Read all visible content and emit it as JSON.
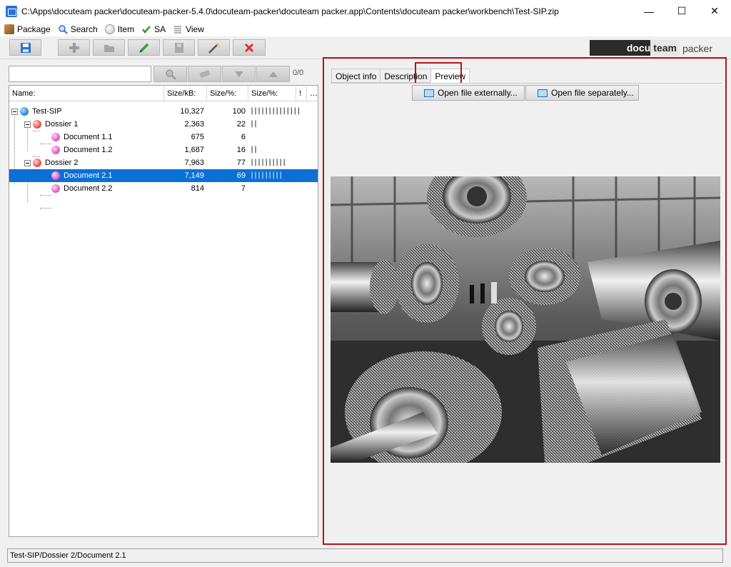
{
  "window": {
    "title": "C:\\Apps\\docuteam packer\\docuteam-packer-5.4.0\\docuteam-packer\\docuteam packer.app\\Contents\\docuteam packer\\workbench\\Test-SIP.zip",
    "minimize": "—",
    "maximize": "☐",
    "close": "✕"
  },
  "menu": {
    "items": [
      {
        "label": "Package",
        "icon": "package-icon"
      },
      {
        "label": "Search",
        "icon": "search-icon"
      },
      {
        "label": "Item",
        "icon": "item-icon"
      },
      {
        "label": "SA",
        "icon": "checkmark-icon"
      },
      {
        "label": "View",
        "icon": "list-icon"
      }
    ]
  },
  "toolbar": {
    "buttons": [
      "save-icon",
      "add-icon",
      "folder-icon",
      "edit-icon",
      "save-disabled-icon",
      "magic-wand-icon",
      "delete-icon"
    ],
    "delete_color": "#e03030",
    "edit_color": "#3aa03a"
  },
  "logo": {
    "part1": "docu",
    "part2": "team",
    "part3": "packer"
  },
  "search": {
    "value": "",
    "placeholder": "",
    "counter": "0/0"
  },
  "tree": {
    "columns": [
      "Name:",
      "Size/kB:",
      "Size/%:",
      "Size/%:",
      "!",
      "…"
    ],
    "rows": [
      {
        "name": "Test-SIP",
        "size_kb": "10,327",
        "size_pct": "100",
        "bars": "||||||||||||||",
        "level": 0,
        "type": "root",
        "expanded": true,
        "selected": false
      },
      {
        "name": "Dossier 1",
        "size_kb": "2,363",
        "size_pct": "22",
        "bars": "||",
        "level": 1,
        "type": "dossier",
        "expanded": true,
        "selected": false
      },
      {
        "name": "Document 1.1",
        "size_kb": "675",
        "size_pct": "6",
        "bars": "",
        "level": 2,
        "type": "doc",
        "selected": false
      },
      {
        "name": "Document 1.2",
        "size_kb": "1,687",
        "size_pct": "16",
        "bars": "||",
        "level": 2,
        "type": "doc",
        "selected": false
      },
      {
        "name": "Dossier 2",
        "size_kb": "7,963",
        "size_pct": "77",
        "bars": "||||||||||",
        "level": 1,
        "type": "dossier",
        "expanded": true,
        "selected": false
      },
      {
        "name": "Document 2.1",
        "size_kb": "7,149",
        "size_pct": "69",
        "bars": "|||||||||",
        "level": 2,
        "type": "doc",
        "selected": true
      },
      {
        "name": "Document 2.2",
        "size_kb": "814",
        "size_pct": "7",
        "bars": "",
        "level": 2,
        "type": "doc",
        "selected": false
      }
    ]
  },
  "details": {
    "tabs": [
      "Object info",
      "Description",
      "Preview"
    ],
    "active_tab": "Preview",
    "open_externally": "Open file externally...",
    "open_separately": "Open file separately...",
    "preview_subject": "black-and-white photograph of turbine rotors in a factory hall"
  },
  "status": {
    "path": "Test-SIP/Dossier 2/Document 2.1"
  },
  "colors": {
    "selection": "#0a70d6",
    "highlight_border": "#b51418"
  }
}
